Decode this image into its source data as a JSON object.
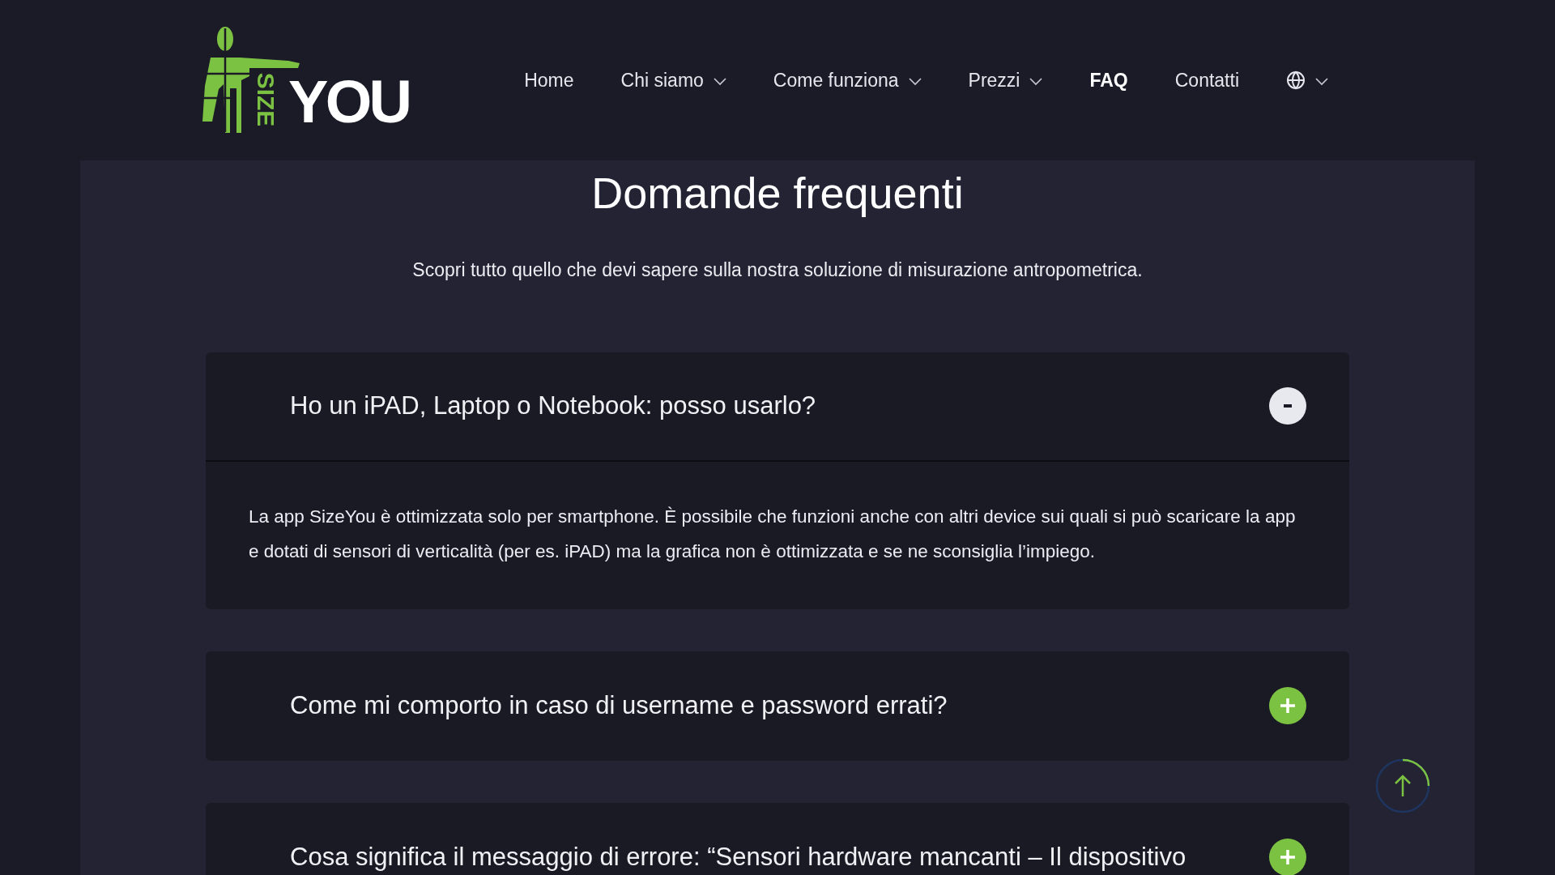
{
  "logo": {
    "word_left": "SIZE",
    "word_right": "YOU"
  },
  "nav": [
    {
      "label": "Home",
      "dropdown": false,
      "selected": false
    },
    {
      "label": "Chi siamo",
      "dropdown": true,
      "selected": false
    },
    {
      "label": "Come funziona",
      "dropdown": true,
      "selected": false
    },
    {
      "label": "Prezzi",
      "dropdown": true,
      "selected": false
    },
    {
      "label": "FAQ",
      "dropdown": false,
      "selected": true
    },
    {
      "label": "Contatti",
      "dropdown": false,
      "selected": false
    }
  ],
  "language_menu": {
    "dropdown": true
  },
  "page": {
    "title": "Domande frequenti",
    "subtitle": "Scopri tutto quello che devi sapere sulla nostra soluzione di misurazione antropometrica."
  },
  "faq": [
    {
      "question": "Ho un iPAD, Laptop o Notebook: posso usarlo?",
      "expanded": true,
      "answer": "La app SizeYou è ottimizzata solo per smartphone. È possibile che funzioni anche con altri device sui quali si può scaricare la app e dotati di sensori di verticalità (per es. iPAD) ma la grafica non è ottimizzata e se ne sconsiglia l’impiego."
    },
    {
      "question": "Come mi comporto in caso di username e password errati?",
      "expanded": false
    },
    {
      "question": "Cosa significa il messaggio di errore: “Sensori hardware mancanti – Il dispositivo",
      "expanded": false
    }
  ]
}
